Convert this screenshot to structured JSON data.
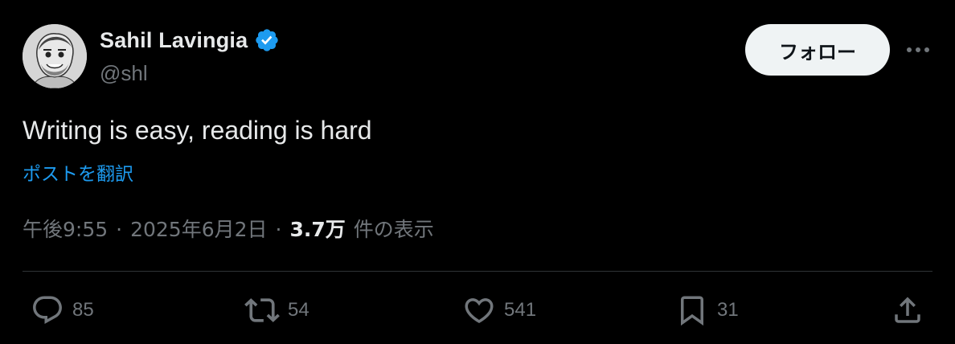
{
  "author": {
    "display_name": "Sahil Lavingia",
    "handle": "@shl",
    "verified": true,
    "verified_color": "#1d9bf0"
  },
  "follow_label": "フォロー",
  "tweet": {
    "text": "Writing is easy, reading is hard",
    "translate_label": "ポストを翻訳"
  },
  "meta": {
    "time": "午後9:55",
    "separator": "·",
    "date": "2025年6月2日",
    "views_count": "3.7万",
    "views_label": "件の表示"
  },
  "actions": {
    "replies": "85",
    "reposts": "54",
    "likes": "541",
    "bookmarks": "31"
  },
  "colors": {
    "background": "#000000",
    "text": "#e7e9ea",
    "muted": "#71767b",
    "accent": "#1d9bf0",
    "divider": "#2f3336"
  },
  "icons": [
    "verified-badge-icon",
    "more-icon",
    "reply-icon",
    "repost-icon",
    "like-icon",
    "bookmark-icon",
    "share-icon"
  ]
}
